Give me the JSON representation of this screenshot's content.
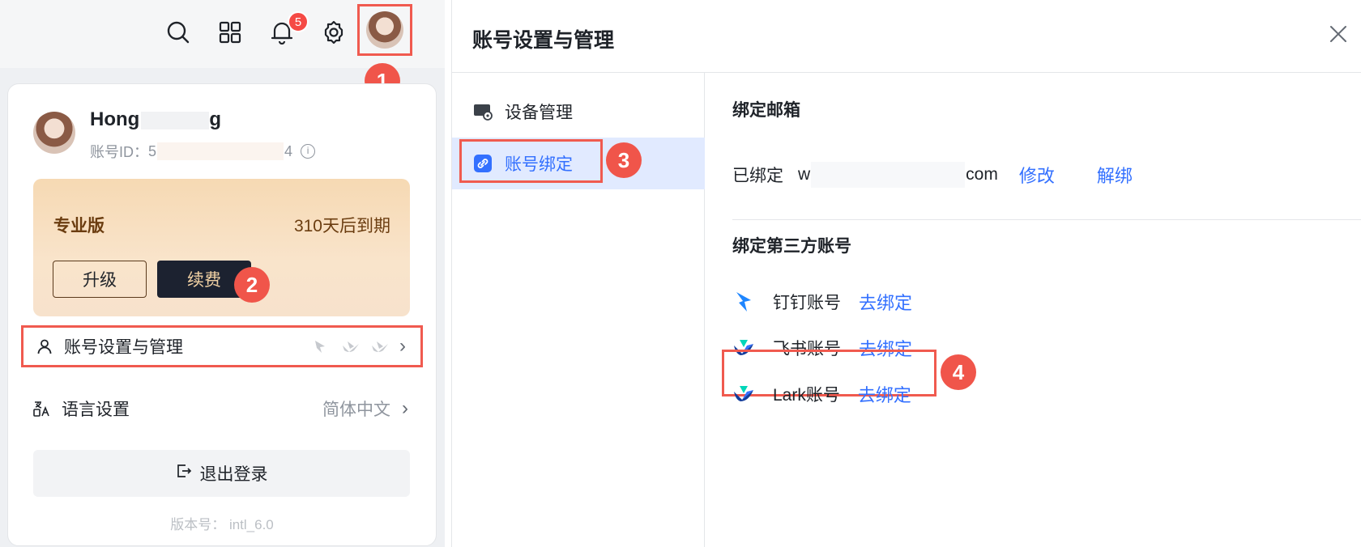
{
  "topbar": {
    "icons": [
      "search-icon",
      "apps-grid-icon",
      "bell-icon",
      "gear-icon"
    ],
    "notification_count": "5"
  },
  "callouts": [
    "1",
    "2",
    "3",
    "4"
  ],
  "user": {
    "name_visible": "Hong",
    "name_tail": "g",
    "id_label": "账号ID：",
    "id_head": "5",
    "id_tail": "4"
  },
  "membership": {
    "plan": "专业版",
    "expiry": "310天后到期",
    "upgrade_label": "升级",
    "renew_label": "续费"
  },
  "menu": {
    "account_settings": "账号设置与管理",
    "language_label": "语言设置",
    "language_value": "简体中文",
    "logout_label": "退出登录",
    "version": "版本号：  intl_6.0"
  },
  "dialog": {
    "title": "账号设置与管理",
    "nav": {
      "device": "设备管理",
      "binding": "账号绑定"
    },
    "email": {
      "section_title": "绑定邮箱",
      "status": "已绑定",
      "email_head": "w",
      "email_tail": "com",
      "modify": "修改",
      "unbind": "解绑"
    },
    "third_party": {
      "section_title": "绑定第三方账号",
      "items": [
        {
          "name": "钉钉账号",
          "action": "去绑定"
        },
        {
          "name": "飞书账号",
          "action": "去绑定"
        },
        {
          "name": "Lark账号",
          "action": "去绑定"
        }
      ]
    }
  },
  "colors": {
    "accent": "#3370ff",
    "callout": "#f0554a",
    "badge": "#f54a45",
    "renew_bg": "#1c2230"
  }
}
